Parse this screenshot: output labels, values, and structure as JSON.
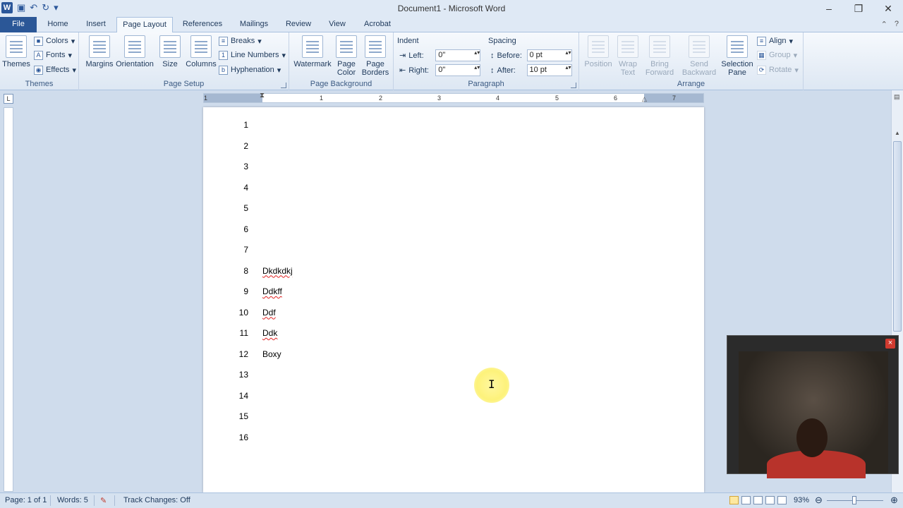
{
  "titlebar": {
    "title": "Document1 - Microsoft Word",
    "app_icon": "W"
  },
  "tabs": [
    {
      "label": "File"
    },
    {
      "label": "Home"
    },
    {
      "label": "Insert"
    },
    {
      "label": "Page Layout"
    },
    {
      "label": "References"
    },
    {
      "label": "Mailings"
    },
    {
      "label": "Review"
    },
    {
      "label": "View"
    },
    {
      "label": "Acrobat"
    }
  ],
  "ribbon": {
    "themes": {
      "themes_label": "Themes",
      "colors": "Colors",
      "fonts": "Fonts",
      "effects": "Effects",
      "group": "Themes"
    },
    "page_setup": {
      "margins": "Margins",
      "orientation": "Orientation",
      "size": "Size",
      "columns": "Columns",
      "breaks": "Breaks",
      "line_numbers": "Line Numbers",
      "hyphenation": "Hyphenation",
      "group": "Page Setup"
    },
    "page_background": {
      "watermark": "Watermark",
      "page_color_1": "Page",
      "page_color_2": "Color",
      "page_borders_1": "Page",
      "page_borders_2": "Borders",
      "group": "Page Background"
    },
    "paragraph": {
      "indent_label": "Indent",
      "spacing_label": "Spacing",
      "left_label": "Left:",
      "left_value": "0\"",
      "right_label": "Right:",
      "right_value": "0\"",
      "before_label": "Before:",
      "before_value": "0 pt",
      "after_label": "After:",
      "after_value": "10 pt",
      "group": "Paragraph"
    },
    "arrange": {
      "position": "Position",
      "wrap_1": "Wrap",
      "wrap_2": "Text",
      "bring_1": "Bring",
      "bring_2": "Forward",
      "send_1": "Send",
      "send_2": "Backward",
      "selection_1": "Selection",
      "selection_2": "Pane",
      "align": "Align",
      "group_btn": "Group",
      "rotate": "Rotate",
      "group": "Arrange"
    }
  },
  "ruler": {
    "numbers": [
      "1",
      "1",
      "2",
      "3",
      "4",
      "5",
      "6",
      "7"
    ]
  },
  "document": {
    "lines": [
      {
        "num": "1",
        "text": ""
      },
      {
        "num": "2",
        "text": ""
      },
      {
        "num": "3",
        "text": ""
      },
      {
        "num": "4",
        "text": ""
      },
      {
        "num": "5",
        "text": ""
      },
      {
        "num": "6",
        "text": ""
      },
      {
        "num": "7",
        "text": ""
      },
      {
        "num": "8",
        "text": "Dkdkdkj"
      },
      {
        "num": "9",
        "text": "Ddkff"
      },
      {
        "num": "10",
        "text": "Ddf"
      },
      {
        "num": "11",
        "text": "Ddk"
      },
      {
        "num": "12",
        "text": "Boxy"
      },
      {
        "num": "13",
        "text": ""
      },
      {
        "num": "14",
        "text": ""
      },
      {
        "num": "15",
        "text": ""
      },
      {
        "num": "16",
        "text": ""
      }
    ]
  },
  "webcam": {
    "close": "×"
  },
  "status": {
    "page": "Page: 1 of 1",
    "words": "Words: 5",
    "track_changes": "Track Changes: Off",
    "zoom": "93%"
  }
}
